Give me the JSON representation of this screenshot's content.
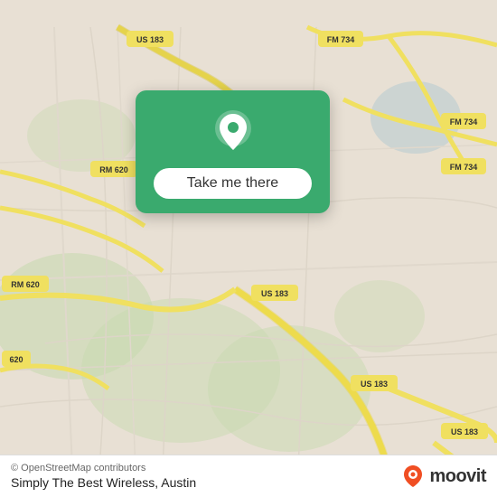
{
  "map": {
    "background_color": "#e8e0d4",
    "attribution": "© OpenStreetMap contributors",
    "place_name": "Simply The Best Wireless, Austin"
  },
  "card": {
    "button_label": "Take me there",
    "pin_icon": "location-pin"
  },
  "branding": {
    "moovit_text": "moovit",
    "logo_icon": "moovit-pin"
  },
  "road_labels": [
    {
      "id": "us183_top",
      "text": "US 183"
    },
    {
      "id": "fm734_top",
      "text": "FM 734"
    },
    {
      "id": "fm734_mid",
      "text": "FM 734"
    },
    {
      "id": "fm734_bot",
      "text": "FM 734"
    },
    {
      "id": "rm620_left",
      "text": "RM 620"
    },
    {
      "id": "rm620_top",
      "text": "RM 620"
    },
    {
      "id": "us183_mid",
      "text": "US 183"
    },
    {
      "id": "us183_bot1",
      "text": "US 183"
    },
    {
      "id": "us183_bot2",
      "text": "US 183"
    },
    {
      "id": "620_bot",
      "text": "620"
    }
  ]
}
